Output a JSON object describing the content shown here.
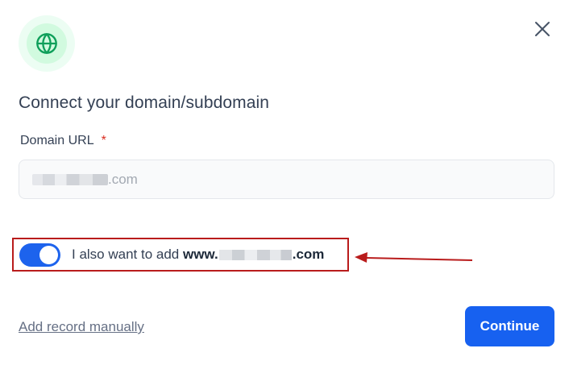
{
  "dialog": {
    "title": "Connect your domain/subdomain",
    "icon": "globe-icon",
    "close_icon": "close-icon"
  },
  "form": {
    "domain_label": "Domain URL",
    "required_mark": "*",
    "domain_suffix": ".com"
  },
  "toggle": {
    "checked": true,
    "text_prefix": "I also want to add ",
    "text_bold_prefix": "www.",
    "text_bold_suffix": ".com"
  },
  "actions": {
    "manual_link": "Add record manually",
    "continue_label": "Continue"
  },
  "colors": {
    "primary": "#1761f0",
    "icon_green": "#12b76a",
    "annotation_red": "#b91c1c"
  }
}
